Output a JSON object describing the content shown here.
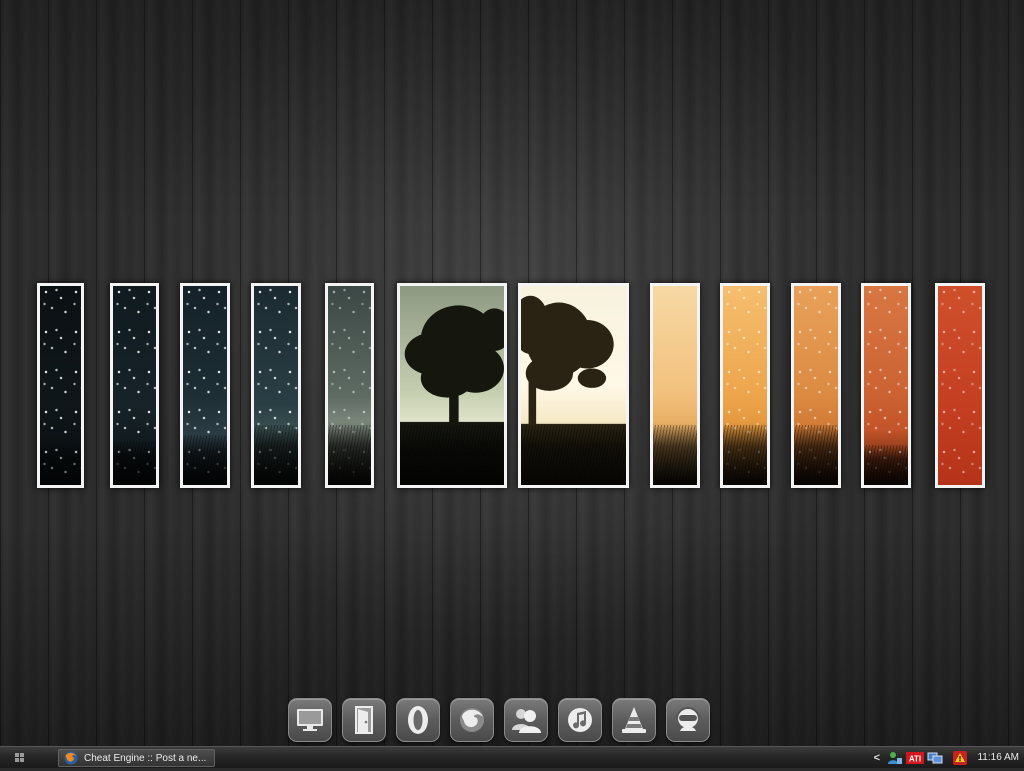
{
  "desktop": {
    "wallpaper": "gradient-panels-tree",
    "panels": [
      {
        "id": "p1",
        "tone": "#0e1417"
      },
      {
        "id": "p2",
        "tone": "#162127"
      },
      {
        "id": "p3",
        "tone": "#1a2a30"
      },
      {
        "id": "p4",
        "tone": "#23373c"
      },
      {
        "id": "p5",
        "tone": "#4d5a55"
      },
      {
        "id": "p6",
        "tone": "#b9c4a5"
      },
      {
        "id": "p7",
        "tone": "#f3ecd6"
      },
      {
        "id": "p8",
        "tone": "#f2c98a"
      },
      {
        "id": "p9",
        "tone": "#eba653"
      },
      {
        "id": "p10",
        "tone": "#d5823c"
      },
      {
        "id": "p11",
        "tone": "#c9602d"
      },
      {
        "id": "p12",
        "tone": "#c13f22"
      }
    ]
  },
  "dock": {
    "items": [
      {
        "name": "monitor-icon"
      },
      {
        "name": "door-icon"
      },
      {
        "name": "opera-icon"
      },
      {
        "name": "firefox-icon"
      },
      {
        "name": "messenger-icon"
      },
      {
        "name": "itunes-icon"
      },
      {
        "name": "vlc-cone-icon"
      },
      {
        "name": "headset-user-icon"
      }
    ]
  },
  "taskbar": {
    "task": {
      "icon": "firefox-icon",
      "label": "Cheat Engine :: Post a ne..."
    },
    "tray": {
      "chevron": "<",
      "icons": [
        "network-user-icon",
        "ati-icon",
        "network-monitor-icon",
        "security-alert-icon"
      ],
      "ati_text": "ATI",
      "clock": "11:16 AM"
    }
  },
  "colors": {
    "panel_border": "#f4f4f4",
    "taskbar_bg": "#262626",
    "dock_icon_bg": "#5c5c5c"
  }
}
